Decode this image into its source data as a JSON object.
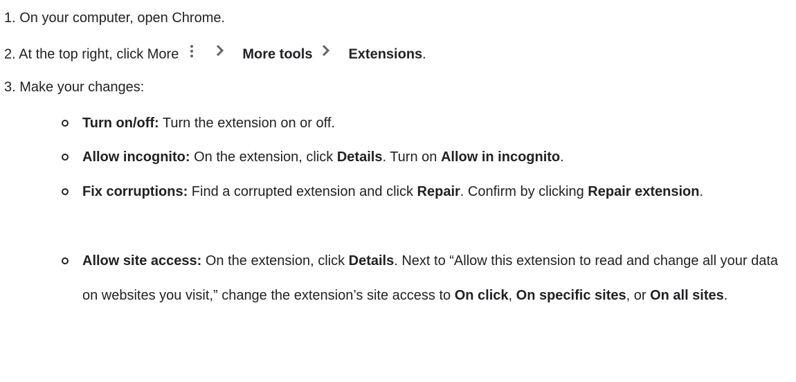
{
  "steps": {
    "s1": "1. On your computer, open Chrome.",
    "s2": {
      "prefix": "2. At the top right, click More",
      "more_tools": "More tools",
      "extensions": "Extensions",
      "period": "."
    },
    "s3": "3. Make your changes:"
  },
  "items": {
    "turn_on_off": {
      "term": "Turn on/off:",
      "text": " Turn the extension on or off."
    },
    "allow_incognito": {
      "term": "Allow incognito:",
      "t1": " On the extension, click ",
      "b1": "Details",
      "t2": ". Turn on ",
      "b2": "Allow in incognito",
      "t3": "."
    },
    "fix_corruptions": {
      "term": "Fix corruptions:",
      "t1": " Find a corrupted extension and click ",
      "b1": "Repair",
      "t2": ". Confirm by clicking ",
      "b2": "Repair extension",
      "t3": "."
    },
    "allow_site_access": {
      "term": "Allow site access:",
      "t1": " On the extension, click ",
      "b1": "Details",
      "t2": ". Next to “Allow this extension to read and change all your data on websites you visit,” change the extension’s site access to ",
      "b2": "On click",
      "t3": ", ",
      "b3": "On specific sites",
      "t4": ", or ",
      "b4": "On all sites",
      "t5": "."
    }
  },
  "icons": {
    "more": "more-vert-icon",
    "chevron": "chevron-right-icon"
  },
  "colors": {
    "text": "#202124",
    "icon": "#5f6368"
  }
}
